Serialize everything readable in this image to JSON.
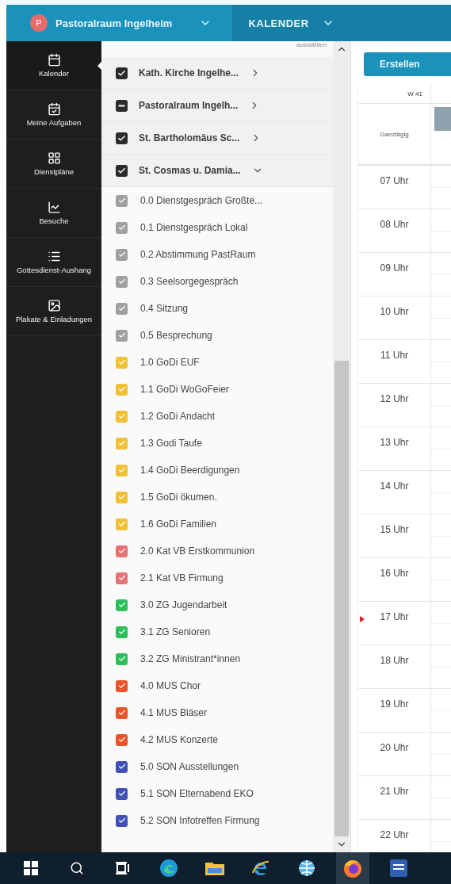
{
  "topbar": {
    "avatar_letter": "P",
    "organization": "Pastoralraum Ingelheim",
    "module": "KALENDER"
  },
  "sidebar": {
    "items": [
      {
        "label": "Kalender",
        "selected": true
      },
      {
        "label": "Meine Aufgaben",
        "selected": false
      },
      {
        "label": "Dienstpläne",
        "selected": false
      },
      {
        "label": "Besuche",
        "selected": false
      },
      {
        "label": "Gottesdienst-Aushang",
        "selected": false
      },
      {
        "label": "Plakate & Einladungen",
        "selected": false
      }
    ]
  },
  "calendar_list": {
    "select_hint": "auswählen",
    "groups": [
      {
        "label": "Kath. Kirche Ingelhe...",
        "checked": true,
        "mixed": false,
        "expanded": false
      },
      {
        "label": "Pastoralraum Ingelh...",
        "checked": true,
        "mixed": true,
        "expanded": false
      },
      {
        "label": "St. Bartholomäus Sc...",
        "checked": true,
        "mixed": false,
        "expanded": false
      },
      {
        "label": "St. Cosmas u. Damia...",
        "checked": true,
        "mixed": false,
        "expanded": true
      }
    ],
    "items": [
      {
        "label": "0.0 Dienstgespräch Großte...",
        "checked": true,
        "color": "#a0a0a0"
      },
      {
        "label": "0.1 Dienstgespräch Lokal",
        "checked": true,
        "color": "#a0a0a0"
      },
      {
        "label": "0.2 Abstimmung PastRaum",
        "checked": true,
        "color": "#a0a0a0"
      },
      {
        "label": "0.3 Seelsorgegespräch",
        "checked": true,
        "color": "#a0a0a0"
      },
      {
        "label": "0.4 Sitzung",
        "checked": true,
        "color": "#a0a0a0"
      },
      {
        "label": "0.5 Besprechung",
        "checked": true,
        "color": "#a0a0a0"
      },
      {
        "label": "1.0 GoDi EUF",
        "checked": true,
        "color": "#f2c037"
      },
      {
        "label": "1.1 GoDi WoGoFeier",
        "checked": true,
        "color": "#f2c037"
      },
      {
        "label": "1.2 GoDi Andacht",
        "checked": true,
        "color": "#f2c037"
      },
      {
        "label": "1.3 Godi Taufe",
        "checked": true,
        "color": "#f2c037"
      },
      {
        "label": "1.4 GoDi Beerdigungen",
        "checked": true,
        "color": "#f2c037"
      },
      {
        "label": "1.5 GoDi ökumen.",
        "checked": true,
        "color": "#f2c037"
      },
      {
        "label": "1.6 GoDi Familien",
        "checked": true,
        "color": "#f2c037"
      },
      {
        "label": "2.0 Kat VB Erstkommunion",
        "checked": true,
        "color": "#e57373"
      },
      {
        "label": "2.1 Kat VB Firmung",
        "checked": true,
        "color": "#e57373"
      },
      {
        "label": "3.0 ZG Jugendarbeit",
        "checked": true,
        "color": "#2dbd5a"
      },
      {
        "label": "3.1 ZG Senioren",
        "checked": true,
        "color": "#2dbd5a"
      },
      {
        "label": "3.2 ZG Ministrant*innen",
        "checked": true,
        "color": "#2dbd5a"
      },
      {
        "label": "4.0 MUS Chor",
        "checked": true,
        "color": "#e8532a"
      },
      {
        "label": "4.1 MUS Bläser",
        "checked": true,
        "color": "#e8532a"
      },
      {
        "label": "4.2 MUS Konzerte",
        "checked": true,
        "color": "#e8532a"
      },
      {
        "label": "5.0 SON Ausstellungen",
        "checked": true,
        "color": "#3f51b5"
      },
      {
        "label": "5.1 SON Elternabend EKO",
        "checked": true,
        "color": "#3f51b5"
      },
      {
        "label": "5.2 SON Infotreffen Firmung",
        "checked": true,
        "color": "#3f51b5"
      }
    ]
  },
  "calendar": {
    "create_button": "Erstellen",
    "week": "W 41",
    "all_day": "Ganztägig",
    "hours": [
      "07 Uhr",
      "08 Uhr",
      "09 Uhr",
      "10 Uhr",
      "11 Uhr",
      "12 Uhr",
      "13 Uhr",
      "14 Uhr",
      "15 Uhr",
      "16 Uhr",
      "17 Uhr",
      "18 Uhr",
      "19 Uhr",
      "20 Uhr",
      "21 Uhr",
      "22 Uhr"
    ]
  },
  "taskbar": {
    "apps": [
      {
        "selected": false
      },
      {
        "selected": false
      },
      {
        "selected": false
      },
      {
        "selected": false
      },
      {
        "selected": false
      },
      {
        "selected": false
      },
      {
        "selected": false
      },
      {
        "selected": true
      },
      {
        "selected": false
      }
    ]
  }
}
